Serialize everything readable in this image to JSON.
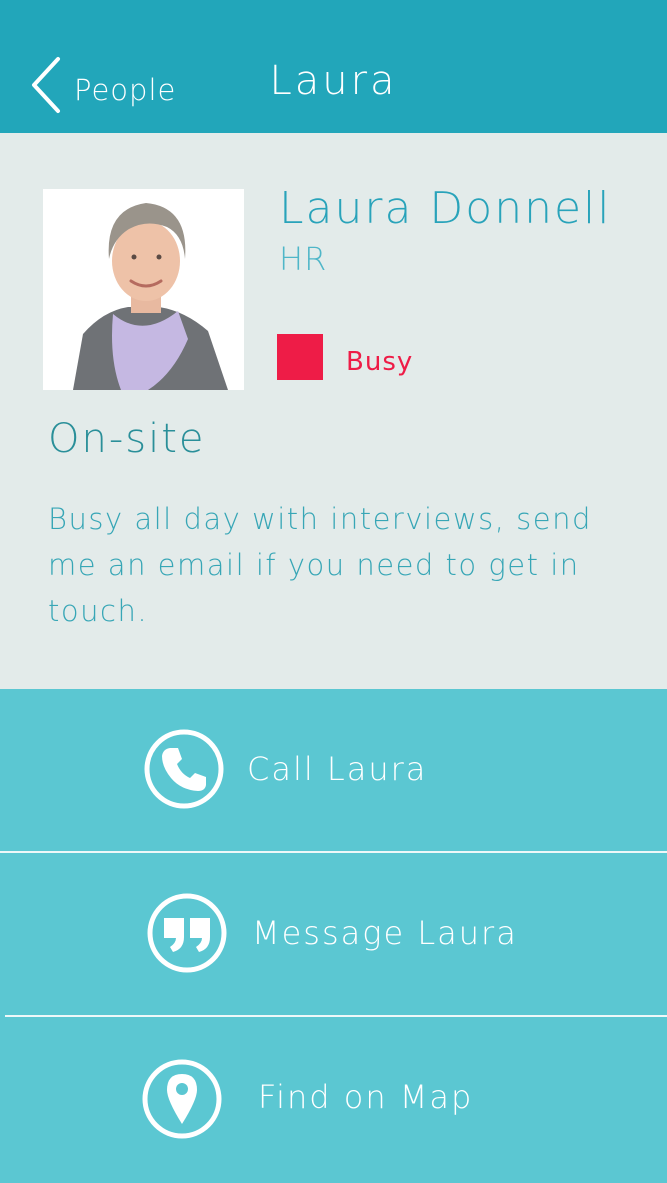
{
  "header": {
    "back_label": "People",
    "title": "Laura",
    "background": "#22a6ba"
  },
  "profile": {
    "name": "Laura Donnell",
    "department": "HR",
    "status": {
      "label": "Busy",
      "color": "#ee1c47"
    },
    "location": "On-site",
    "note": "Busy all day with interviews, send me an email if you need to get in touch."
  },
  "actions": [
    {
      "label": "Call Laura",
      "icon": "phone-icon"
    },
    {
      "label": "Message Laura",
      "icon": "quote-icon"
    },
    {
      "label": "Find on Map",
      "icon": "map-pin-icon"
    }
  ],
  "colors": {
    "accent": "#29a3ba",
    "actions_background": "#5bc7d2",
    "page_background": "#e3ebea"
  }
}
